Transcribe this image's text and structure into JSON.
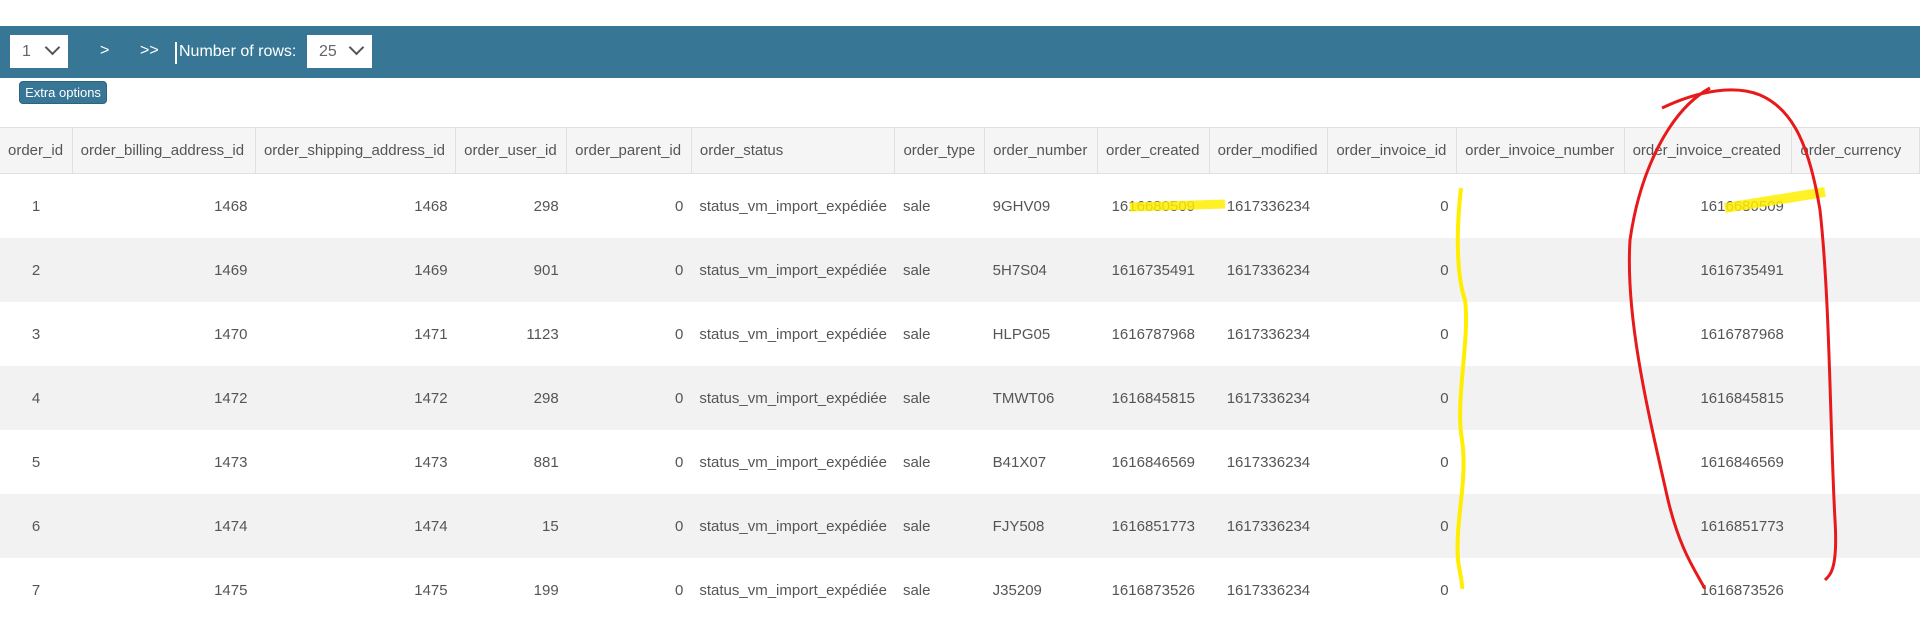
{
  "toolbar": {
    "page_select": "1",
    "next_label": ">",
    "last_label": ">>",
    "rows_label": "Number of rows:",
    "rows_select": "25",
    "color": "#377795"
  },
  "extra_options_label": "Extra options",
  "table": {
    "columns": [
      "order_id",
      "order_billing_address_id",
      "order_shipping_address_id",
      "order_user_id",
      "order_parent_id",
      "order_status",
      "order_type",
      "order_number",
      "order_created",
      "order_modified",
      "order_invoice_id",
      "order_invoice_number",
      "order_invoice_created",
      "order_currency"
    ],
    "rows": [
      [
        "1",
        "1468",
        "1468",
        "298",
        "0",
        "status_vm_import_expédiée",
        "sale",
        "9GHV09",
        "1616680509",
        "1617336234",
        "0",
        "",
        "1616680509",
        ""
      ],
      [
        "2",
        "1469",
        "1469",
        "901",
        "0",
        "status_vm_import_expédiée",
        "sale",
        "5H7S04",
        "1616735491",
        "1617336234",
        "0",
        "",
        "1616735491",
        ""
      ],
      [
        "3",
        "1470",
        "1471",
        "1123",
        "0",
        "status_vm_import_expédiée",
        "sale",
        "HLPG05",
        "1616787968",
        "1617336234",
        "0",
        "",
        "1616787968",
        ""
      ],
      [
        "4",
        "1472",
        "1472",
        "298",
        "0",
        "status_vm_import_expédiée",
        "sale",
        "TMWT06",
        "1616845815",
        "1617336234",
        "0",
        "",
        "1616845815",
        ""
      ],
      [
        "5",
        "1473",
        "1473",
        "881",
        "0",
        "status_vm_import_expédiée",
        "sale",
        "B41X07",
        "1616846569",
        "1617336234",
        "0",
        "",
        "1616846569",
        ""
      ],
      [
        "6",
        "1474",
        "1474",
        "15",
        "0",
        "status_vm_import_expédiée",
        "sale",
        "FJY508",
        "1616851773",
        "1617336234",
        "0",
        "",
        "1616851773",
        ""
      ],
      [
        "7",
        "1475",
        "1475",
        "199",
        "0",
        "status_vm_import_expédiée",
        "sale",
        "J35209",
        "1616873526",
        "1617336234",
        "0",
        "",
        "1616873526",
        ""
      ]
    ]
  },
  "annotations": {
    "highlight_color": "#ffee00",
    "circle_color": "#e8191b"
  }
}
